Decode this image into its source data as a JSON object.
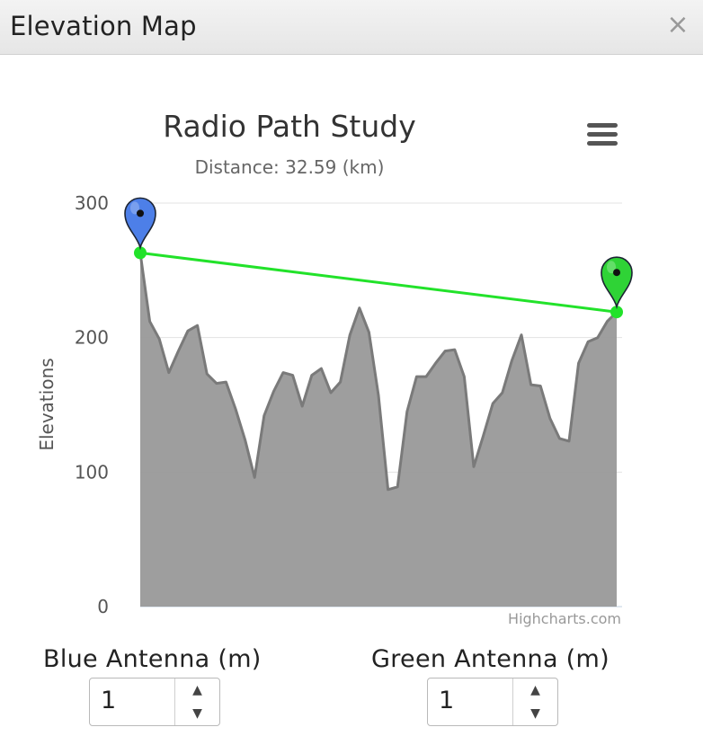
{
  "window": {
    "title": "Elevation Map",
    "close_glyph": "×"
  },
  "chart_data": {
    "type": "area",
    "title": "Radio Path Study",
    "subtitle": "Distance: 32.59 (km)",
    "ylabel": "Elevations",
    "xlabel": "",
    "ylim": [
      0,
      300
    ],
    "yticks": [
      "0",
      "100",
      "200",
      "300"
    ],
    "credits": "Highcharts.com",
    "grid": true,
    "series": [
      {
        "type": "area",
        "color": "#999999",
        "line_color": "#7a7a7a",
        "values": [
          263,
          212,
          199,
          174,
          190,
          205,
          209,
          173,
          166,
          167,
          147,
          124,
          96,
          142,
          160,
          174,
          172,
          149,
          172,
          177,
          159,
          167,
          202,
          222,
          204,
          157,
          87,
          89,
          145,
          171,
          171,
          181,
          190,
          191,
          171,
          104,
          127,
          151,
          159,
          183,
          202,
          165,
          164,
          140,
          125,
          123,
          181,
          197,
          200,
          212,
          219
        ]
      },
      {
        "type": "line",
        "color": "#22e22a",
        "points": [
          [
            0,
            263
          ],
          [
            50,
            219
          ]
        ]
      }
    ],
    "markers": [
      {
        "name": "blue-antenna-marker",
        "color": "#4d7fe8",
        "at": [
          0,
          263
        ]
      },
      {
        "name": "green-antenna-marker",
        "color": "#2fd336",
        "at": [
          50,
          219
        ]
      }
    ]
  },
  "controls": {
    "blue": {
      "label": "Blue Antenna (m)",
      "value": "1"
    },
    "green": {
      "label": "Green Antenna (m)",
      "value": "1"
    }
  }
}
